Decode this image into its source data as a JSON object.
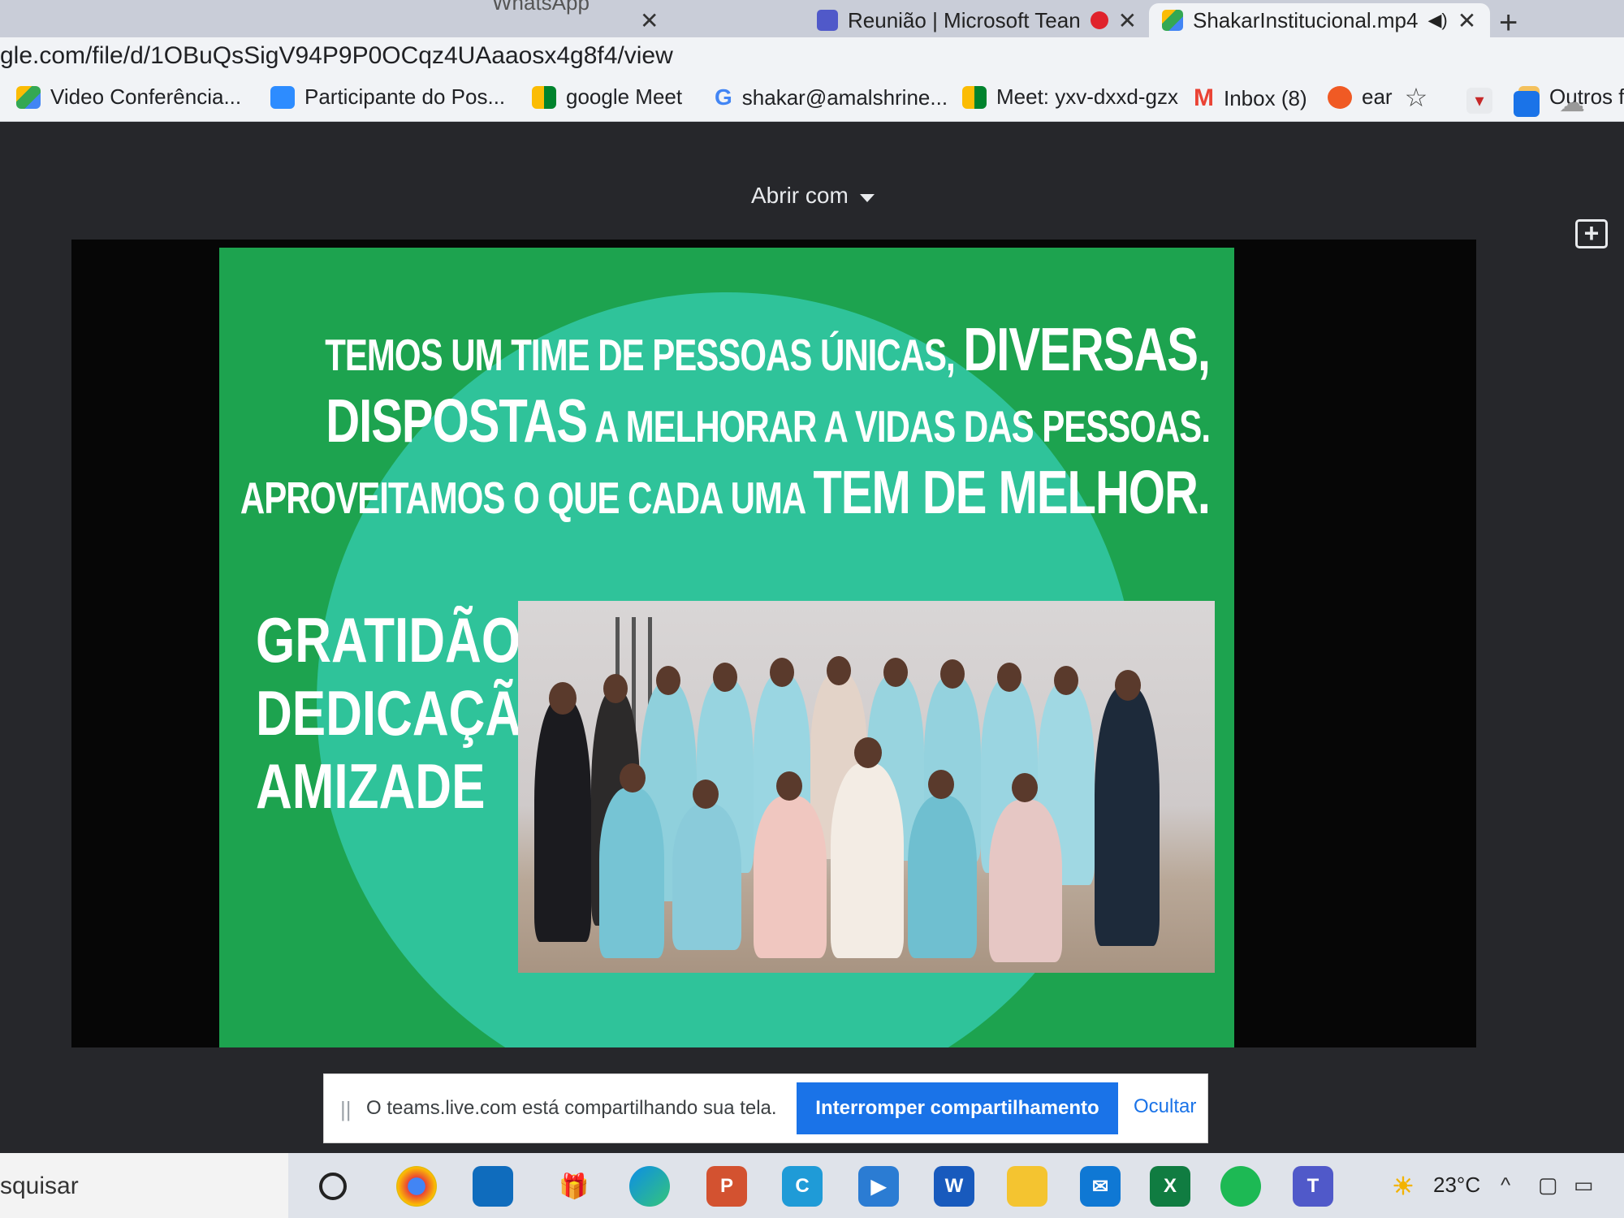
{
  "browser": {
    "tabs": [
      {
        "label": "WhatsApp",
        "closable": true
      },
      {
        "label": "Reunião | Microsoft Tean",
        "recording": true,
        "closable": true
      },
      {
        "label": "ShakarInstitucional.mp4",
        "audio": true,
        "closable": true,
        "active": true
      }
    ],
    "new_tab_symbol": "+",
    "close_symbol": "✕",
    "address": "gle.com/file/d/1OBuQsSigV94P9P0OCqz4UAaaosx4g8f4/view",
    "bookmarks": [
      {
        "label": "Video Conferência...",
        "icon": "drive-icon"
      },
      {
        "label": "Participante do Pos...",
        "icon": "zoom-icon"
      },
      {
        "label": "google Meet",
        "icon": "meet-icon"
      },
      {
        "label": "shakar@amalshrine...",
        "icon": "google-icon"
      },
      {
        "label": "Meet: yxv-dxxd-gzx",
        "icon": "meet-icon"
      },
      {
        "label": "Inbox (8)",
        "icon": "gmail-icon"
      },
      {
        "label": "ear",
        "icon": "orange-dot-icon"
      }
    ],
    "bookmarks_overflow": "»",
    "other_bookmarks": "Outros fa"
  },
  "viewer": {
    "open_with": "Abrir com"
  },
  "slide": {
    "lines": [
      [
        {
          "t": "Temos um time de pessoas únicas, ",
          "s": "sm"
        },
        {
          "t": "Diversas,",
          "s": "big"
        }
      ],
      [
        {
          "t": "Dispostas",
          "s": "big"
        },
        {
          "t": " a melhorar a vidas das pessoas.",
          "s": "sm"
        }
      ],
      [
        {
          "t": "Aproveitamos o que cada uma ",
          "s": "sm"
        },
        {
          "t": "tem de melhor.",
          "s": "big"
        }
      ]
    ],
    "values": [
      "GRATIDÃO",
      "DEDICAÇÃO",
      "AMIZADE"
    ]
  },
  "share_bar": {
    "handle": "||",
    "message": "O teams.live.com está compartilhando sua tela.",
    "stop_label": "Interromper compartilhamento",
    "hide_label": "Ocultar"
  },
  "taskbar": {
    "search_placeholder": "squisar",
    "apps": [
      "chrome-icon",
      "store-icon",
      "gift-icon",
      "edge-icon",
      "powerpoint-icon",
      "app-c-icon",
      "video-icon",
      "word-icon",
      "explorer-icon",
      "mail-icon",
      "excel-icon",
      "spotify-icon",
      "teams-icon"
    ],
    "weather": "23°C"
  }
}
